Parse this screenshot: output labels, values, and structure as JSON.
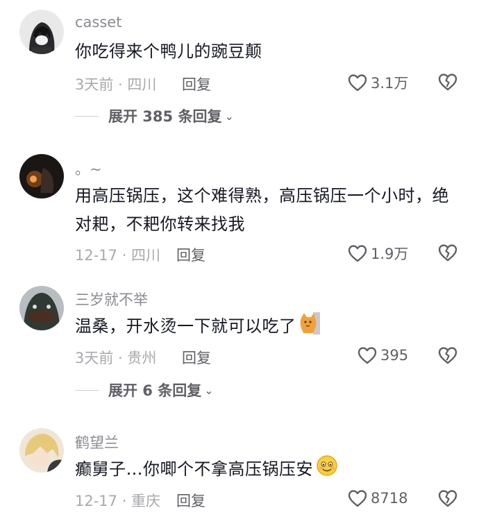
{
  "comments": [
    {
      "username": "casset",
      "text": "你吃得来个鸭儿的豌豆颠",
      "meta": "3天前 · 四川",
      "reply_label": "回复",
      "likes": "3.1万",
      "expand_label": "展开 385 条回复"
    },
    {
      "username": "。~",
      "text": "用高压锅压，这个难得熟，高压锅压一个小时，绝对耙，不耙你转来找我",
      "meta": "12-17 · 四川",
      "reply_label": "回复",
      "likes": "1.9万"
    },
    {
      "username": "三岁就不举",
      "text": "温桑，开水烫一下就可以吃了",
      "meta": "3天前 · 贵州",
      "reply_label": "回复",
      "likes": "395",
      "expand_label": "展开 6 条回复"
    },
    {
      "username": "鹤望兰",
      "text": "癫舅子…你唧个不拿高压锅压安",
      "meta": "12-17 · 重庆",
      "reply_label": "回复",
      "likes": "8718"
    }
  ],
  "icons": {
    "like": "heart-outline-icon",
    "dislike": "broken-heart-icon",
    "expand": "chevron-down-icon"
  },
  "colors": {
    "text": "#161823",
    "secondary": "#8a8b91",
    "meta": "#a8a9ad",
    "action": "#5f6066"
  }
}
